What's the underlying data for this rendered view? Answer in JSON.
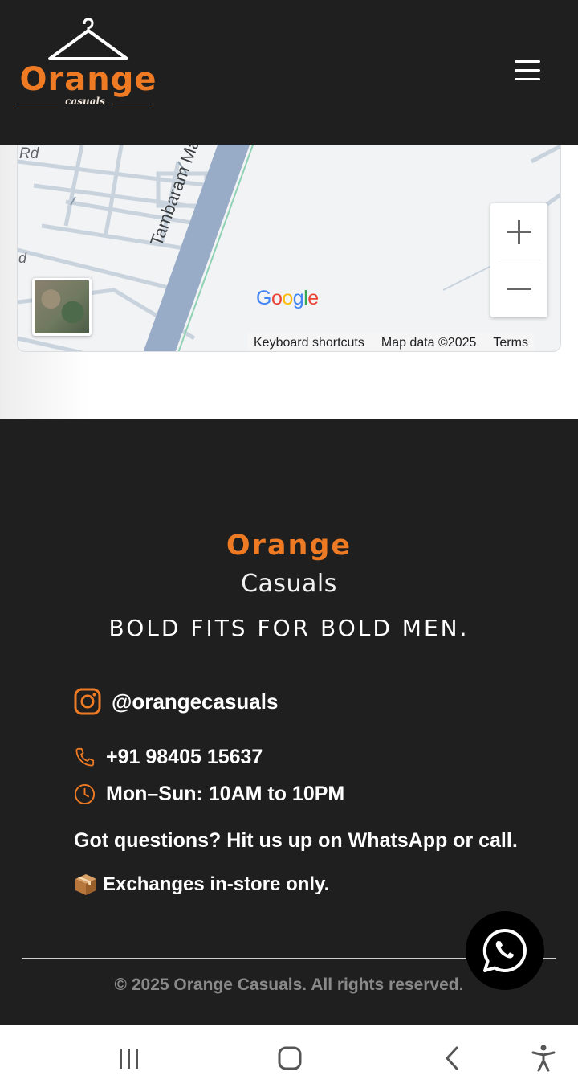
{
  "header": {
    "logo": {
      "word": "Orange",
      "sub": "casuals"
    },
    "menu_icon": "hamburger-menu-icon"
  },
  "map": {
    "road_label": "Tambaram Main Rd",
    "rd_label": "Rd",
    "d_label": "d",
    "zoom_in_label": "+",
    "zoom_out_label": "−",
    "google_logo": "Google",
    "keyboard_shortcuts": "Keyboard shortcuts",
    "map_data": "Map data ©2025",
    "terms": "Terms"
  },
  "footer": {
    "brand_orange": "Orange",
    "brand_casuals": "Casuals",
    "tagline": "BOLD FITS FOR BOLD MEN.",
    "instagram": "@orangecasuals",
    "phone": "+91 98405 15637",
    "hours": "Mon–Sun: 10AM to 10PM",
    "questions": "Got questions? Hit us up on WhatsApp or call.",
    "exchange": "Exchanges in-store only.",
    "copyright": "© 2025 Orange Casuals. All rights reserved."
  },
  "icons": {
    "instagram": "instagram-icon",
    "phone": "phone-icon",
    "clock": "clock-icon",
    "package": "package-icon",
    "whatsapp": "whatsapp-icon"
  },
  "colors": {
    "accent": "#ee7a24",
    "dark_bg": "#1f1f1f",
    "text": "#ffffff",
    "muted": "#8a8a8a"
  },
  "system_nav": {
    "recents": "recents-icon",
    "home": "home-icon",
    "back": "back-icon",
    "accessibility": "accessibility-icon"
  }
}
